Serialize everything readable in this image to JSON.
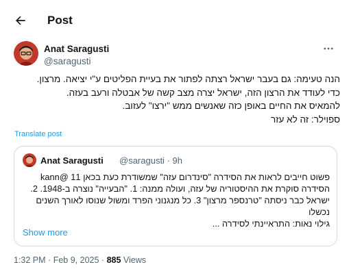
{
  "header": {
    "title": "Post",
    "back_icon": "arrow-left-icon"
  },
  "author": {
    "name": "Anat Saragusti",
    "handle": "@saragusti",
    "more_icon": "more-horizontal-icon"
  },
  "post": {
    "lines": [
      "הנה טעימה: גם בעבר ישראל רצתה לפתור את בעיית הפליטים ע\"י יציאה. מרצון.",
      "כדי לעודד את הרצון הזה, ישראל יצרה מצב קשה של אבטלה ורעב בעזה.",
      "להמאיס את החיים באופן כזה שאנשים ממש \"ירצו\" לעזוב.",
      "ספוילר: זה לא עזר"
    ],
    "translate_label": "Translate post"
  },
  "quote": {
    "name": "Anat Saragusti",
    "handle": "@saragusti",
    "separator": "·",
    "time": "9h",
    "lines": [
      "פשוט חייבים לראות את הסידרה \"סינדרום עזה\" שמשודרת כעת בכאן 11 @kann",
      "הסידרה סוקרת את ההיסטוריה של עזה, ועולה ממנה: 1. \"הבעייה\" נוצרה ב-1948. 2.",
      "ישראל כבר ניסתה \"טרנספר מרצון\" 3. כל מנגנוני הפרד ומשול שנוסו לאורך השנים",
      "נכשלו",
      "גילוי נאות: התראיינתי לסידרה ..."
    ],
    "show_more_label": "Show more"
  },
  "meta": {
    "time": "1:32 PM",
    "separator": "·",
    "date": "Feb 9, 2025",
    "separator2": "·",
    "views_count": "885",
    "views_label": "Views"
  },
  "colors": {
    "link": "#1d9bf0",
    "muted": "#536471",
    "border": "#cfd9de",
    "text": "#0f1419"
  }
}
